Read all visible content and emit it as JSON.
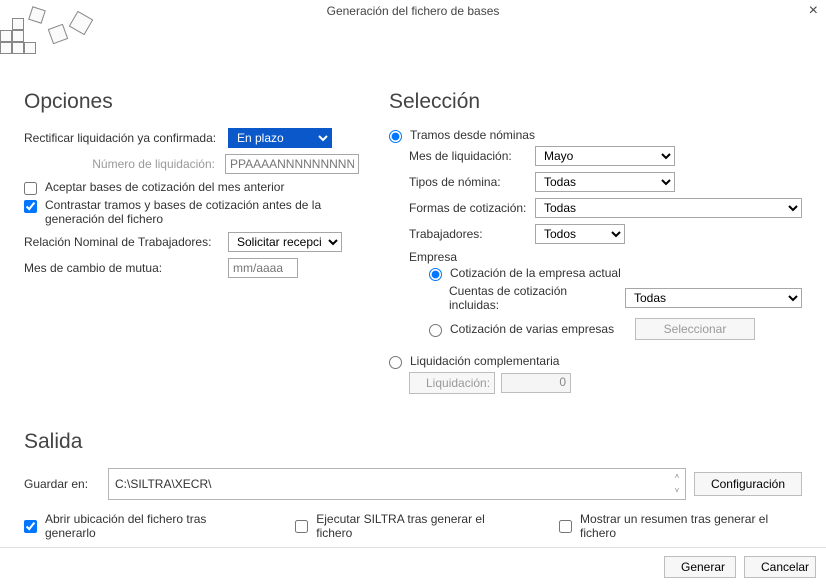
{
  "window": {
    "title": "Generación del fichero de bases"
  },
  "opciones": {
    "heading": "Opciones",
    "rectificar_label": "Rectificar liquidación ya confirmada:",
    "rectificar_value": "En plazo",
    "num_liq_label": "Número de liquidación:",
    "num_liq_placeholder": "PPAAAANNNNNNNNNNDC",
    "cb_aceptar": "Aceptar bases de cotización del mes anterior",
    "cb_contrastar": "Contrastar tramos y bases de cotización antes de la generación del fichero",
    "rnt_label": "Relación Nominal de Trabajadores:",
    "rnt_value": "Solicitar recepció",
    "mes_cambio_label": "Mes de cambio de mutua:",
    "mes_cambio_placeholder": "mm/aaaa"
  },
  "seleccion": {
    "heading": "Selección",
    "rb_tramos": "Tramos desde nóminas",
    "mes_liq_label": "Mes de liquidación:",
    "mes_liq_value": "Mayo",
    "tipos_label": "Tipos de nómina:",
    "tipos_value": "Todas",
    "formas_label": "Formas de cotización:",
    "formas_value": "Todas",
    "trab_label": "Trabajadores:",
    "trab_value": "Todos",
    "empresa_label": "Empresa",
    "rb_empresa_actual": "Cotización de la empresa actual",
    "cuentas_label": "Cuentas de cotización incluidas:",
    "cuentas_value": "Todas",
    "rb_varias": "Cotización de varias empresas",
    "btn_seleccionar": "Seleccionar",
    "rb_complementaria": "Liquidación complementaria",
    "liq_btn": "Liquidación:",
    "liq_num": "0"
  },
  "salida": {
    "heading": "Salida",
    "guardar_label": "Guardar en:",
    "path": "C:\\SILTRA\\XECR\\",
    "btn_config": "Configuración",
    "cb_abrir": "Abrir ubicación del fichero tras generarlo",
    "cb_ejecutar": "Ejecutar SILTRA tras generar el fichero",
    "cb_resumen": "Mostrar un resumen tras generar el fichero"
  },
  "footer": {
    "generar": "Generar",
    "cancelar": "Cancelar"
  }
}
